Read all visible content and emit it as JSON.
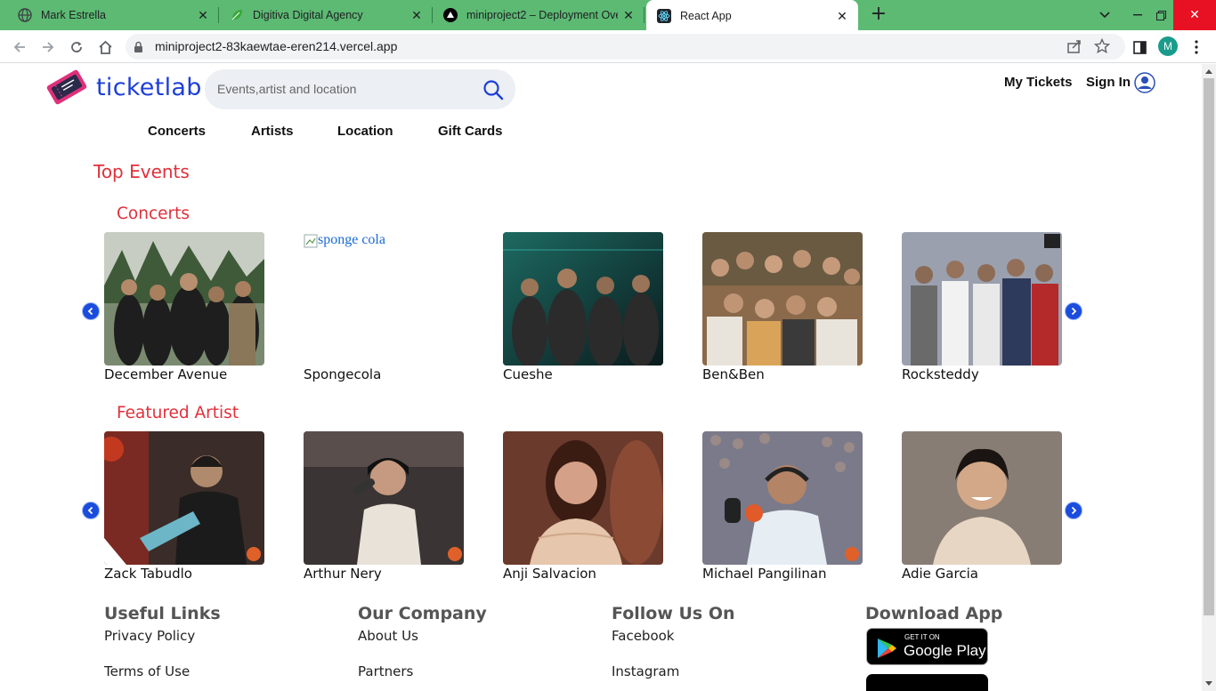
{
  "browser": {
    "tabs": [
      {
        "title": "Mark Estrella",
        "icon": "globe-icon"
      },
      {
        "title": "Digitiva Digital Agency",
        "icon": "leaf-icon"
      },
      {
        "title": "miniproject2 – Deployment Over",
        "icon": "vercel-icon"
      },
      {
        "title": "React App",
        "icon": "react-icon"
      }
    ],
    "url": "miniproject2-83kaewtae-eren214.vercel.app",
    "profile_initial": "M"
  },
  "header": {
    "logo_text": "ticketlab",
    "search_placeholder": "Events,artist and location",
    "my_tickets": "My Tickets",
    "sign_in": "Sign In"
  },
  "nav": {
    "items": [
      "Concerts",
      "Artists",
      "Location",
      "Gift Cards"
    ]
  },
  "main": {
    "top_events_title": "Top Events",
    "concerts": {
      "title": "Concerts",
      "items": [
        {
          "name": "December Avenue"
        },
        {
          "name": "Spongecola",
          "alt": "sponge cola"
        },
        {
          "name": "Cueshe"
        },
        {
          "name": "Ben&Ben"
        },
        {
          "name": "Rocksteddy"
        }
      ]
    },
    "featured": {
      "title": "Featured Artist",
      "items": [
        {
          "name": "Zack Tabudlo"
        },
        {
          "name": "Arthur Nery"
        },
        {
          "name": "Anji Salvacion"
        },
        {
          "name": "Michael Pangilinan"
        },
        {
          "name": "Adie Garcia"
        }
      ]
    }
  },
  "footer": {
    "useful_links": {
      "title": "Useful Links",
      "links": [
        "Privacy Policy",
        "Terms of Use"
      ]
    },
    "company": {
      "title": "Our Company",
      "links": [
        "About Us",
        "Partners"
      ]
    },
    "follow": {
      "title": "Follow Us On",
      "links": [
        "Facebook",
        "Instagram"
      ]
    },
    "download": {
      "title": "Download App",
      "google_play_small": "GET IT ON",
      "google_play_big": "Google Play"
    }
  },
  "colors": {
    "brand_blue": "#1d3fd8",
    "accent_red": "#e0303a",
    "tab_bar_green": "#5cba73"
  }
}
